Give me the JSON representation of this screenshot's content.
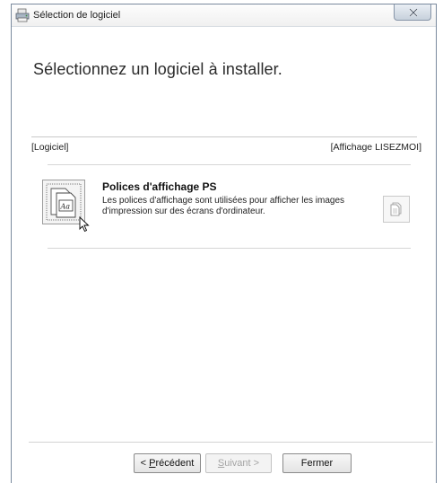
{
  "window": {
    "title": "Sélection de logiciel"
  },
  "main": {
    "heading": "Sélectionnez un logiciel à installer.",
    "column_left": "[Logiciel]",
    "column_right": "[Affichage LISEZMOI]",
    "software": [
      {
        "title": "Polices d'affichage PS",
        "description": "Les polices d'affichage sont utilisées pour afficher les images d'impression sur des écrans d'ordinateur."
      }
    ]
  },
  "footer": {
    "prev": {
      "accel": "P",
      "rest": "récédent",
      "prefix": "< "
    },
    "next": {
      "accel": "S",
      "rest": "uivant",
      "suffix": " >"
    },
    "close": "Fermer"
  },
  "icons": {
    "app": "printer-app-icon",
    "close": "close-icon",
    "software": "font-file-icon",
    "readme": "document-icon",
    "cursor": "mouse-pointer-icon"
  }
}
